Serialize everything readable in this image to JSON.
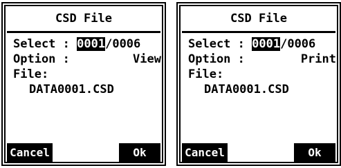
{
  "dialogs": [
    {
      "title": "CSD File",
      "select_label": "Select",
      "select_sep": " : ",
      "select_current": "0001",
      "select_total": "/0006",
      "option_label": "Option",
      "option_sep": " :",
      "option_value": "View",
      "file_label": "File:",
      "file_name": "DATA0001.CSD",
      "cancel_label": "Cancel",
      "ok_label": "Ok"
    },
    {
      "title": "CSD File",
      "select_label": "Select",
      "select_sep": " : ",
      "select_current": "0001",
      "select_total": "/0006",
      "option_label": "Option",
      "option_sep": " :",
      "option_value": "Print",
      "file_label": "File:",
      "file_name": "DATA0001.CSD",
      "cancel_label": "Cancel",
      "ok_label": "Ok"
    }
  ]
}
